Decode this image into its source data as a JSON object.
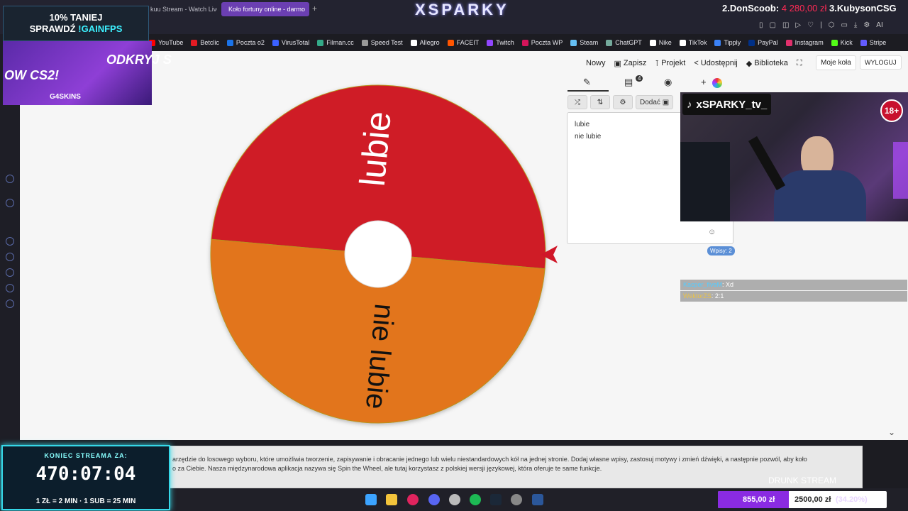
{
  "browser": {
    "tabs": [
      {
        "label": "kuu Stream - Watch Live"
      },
      {
        "label": "Koło fortuny online - darmo"
      }
    ],
    "brand": "XSPARKY",
    "ranks": [
      {
        "label": "2.DonScoob:",
        "amount": "4 280,00 zł"
      },
      {
        "label": "3.KubysonCSG",
        "amount": ""
      }
    ]
  },
  "bookmarks": [
    {
      "label": "YouTube",
      "color": "#ff0000"
    },
    {
      "label": "Betclic",
      "color": "#e31b23"
    },
    {
      "label": "Poczta o2",
      "color": "#1a73e8"
    },
    {
      "label": "VirusTotal",
      "color": "#3b61ff"
    },
    {
      "label": "Filman.cc",
      "color": "#33aa88"
    },
    {
      "label": "Speed Test",
      "color": "#999999"
    },
    {
      "label": "Allegro",
      "color": "#ffffff"
    },
    {
      "label": "FACEIT",
      "color": "#ff5500"
    },
    {
      "label": "Twitch",
      "color": "#9146ff"
    },
    {
      "label": "Poczta WP",
      "color": "#d4145a"
    },
    {
      "label": "Steam",
      "color": "#66c0f4"
    },
    {
      "label": "ChatGPT",
      "color": "#74aa9c"
    },
    {
      "label": "Nike",
      "color": "#ffffff"
    },
    {
      "label": "TikTok",
      "color": "#ffffff"
    },
    {
      "label": "Tipply",
      "color": "#3b82f6"
    },
    {
      "label": "PayPal",
      "color": "#003087"
    },
    {
      "label": "Instagram",
      "color": "#e1306c"
    },
    {
      "label": "Kick",
      "color": "#53fc18"
    },
    {
      "label": "Stripe",
      "color": "#635bff"
    }
  ],
  "menu": {
    "nowy": "Nowy",
    "zapisz": "Zapisz",
    "projekt": "Projekt",
    "udostepnij": "Udostępnij",
    "biblioteka": "Biblioteka",
    "moje_kola": "Moje koła",
    "wyloguj": "WYLOGUJ"
  },
  "wheel": {
    "segments": [
      {
        "label": "lubie",
        "color": "#cf1b28"
      },
      {
        "label": "nie lubie",
        "color": "#e2751a"
      }
    ],
    "pointer_color": "#d01628"
  },
  "editor": {
    "dodac": "Dodać",
    "entries": [
      "lubie",
      "nie lubie"
    ],
    "count": "Wpisy: 2",
    "tab_badge": "4"
  },
  "webcam": {
    "name": "xSPARKY_tv_",
    "age": "18+"
  },
  "chat": [
    {
      "user": "Kacper_fiveM",
      "msg": ": Xd"
    },
    {
      "user": "WektorZS",
      "msg": ": 2:1"
    }
  ],
  "promo": {
    "line1": "10% TANIEJ",
    "line2_prefix": "SPRAWDŹ ",
    "line2_cmd": "!GAINFPS"
  },
  "ad": {
    "t1": "ODKRYJ S",
    "t2": "OW CS2!",
    "brand": "G4SKINS"
  },
  "description": {
    "line1": "arzędzie do losowego wyboru, które umożliwia tworzenie, zapisywanie i obracanie jednego lub wielu niestandardowych kół na jednej stronie. Dodaj własne wpisy, zastosuj motywy i zmień dźwięki, a następnie pozwól, aby koło",
    "line2": "o za Ciebie. Nasza międzynarodowa aplikacja nazywa się Spin the Wheel, ale tutaj korzystasz z polskiej wersji językowej, która oferuje te same funkcje."
  },
  "overlay_text": "DRUNK STREAM",
  "timer": {
    "label": "KONIEC STREAMA ZA:",
    "value": "470:07:04",
    "rates": "1 ZŁ = 2 MIN · 1 SUB = 25 MIN"
  },
  "goal": {
    "current": "855,00 zł",
    "target": "2500,00 zł",
    "percent": "(34.20%)",
    "fill_fraction": 0.342,
    "color": "#8a2be2"
  }
}
